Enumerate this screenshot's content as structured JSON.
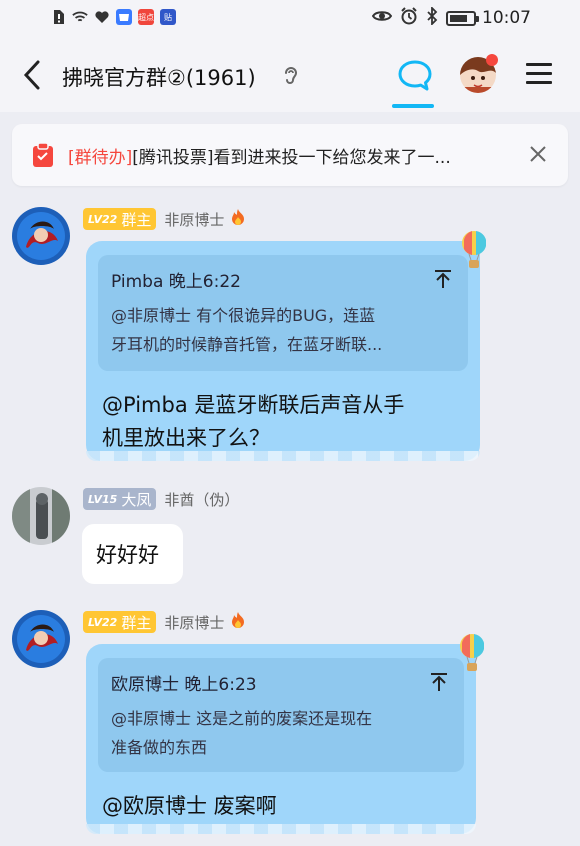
{
  "status_bar": {
    "time": "10:07",
    "app_chips": [
      "超点",
      "贴"
    ],
    "icons": [
      "alert-icon",
      "wifi-icon",
      "health-icon",
      "shopping-icon",
      "eye-icon",
      "alarm-icon",
      "bluetooth-icon",
      "battery-icon"
    ],
    "battery_level": 0.8
  },
  "header": {
    "title": "拂晓官方群②(1961)",
    "accent_color": "#12b7f5"
  },
  "todo": {
    "tag": "[群待办]",
    "text": "[腾讯投票]看到进来投一下给您发来了一..."
  },
  "messages": [
    {
      "level": "LV22",
      "role": "群主",
      "name": "非原博士",
      "quote_header": "Pimba 晚上6:22",
      "quote_lines": [
        "@非原博士 有个很诡异的BUG，连蓝",
        "牙耳机的时候静音托管，在蓝牙断联..."
      ],
      "reply_lines": [
        "@Pimba 是蓝牙断联后声音从手",
        "机里放出来了么？"
      ]
    },
    {
      "level": "LV15",
      "role": "大凤",
      "name": "非酋（伪）",
      "text": "好好好"
    },
    {
      "level": "LV22",
      "role": "群主",
      "name": "非原博士",
      "quote_header": "欧原博士 晚上6:23",
      "quote_lines": [
        "@非原博士 这是之前的废案还是现在",
        "准备做的东西"
      ],
      "reply_lines": [
        "@欧原博士 废案啊"
      ]
    }
  ]
}
